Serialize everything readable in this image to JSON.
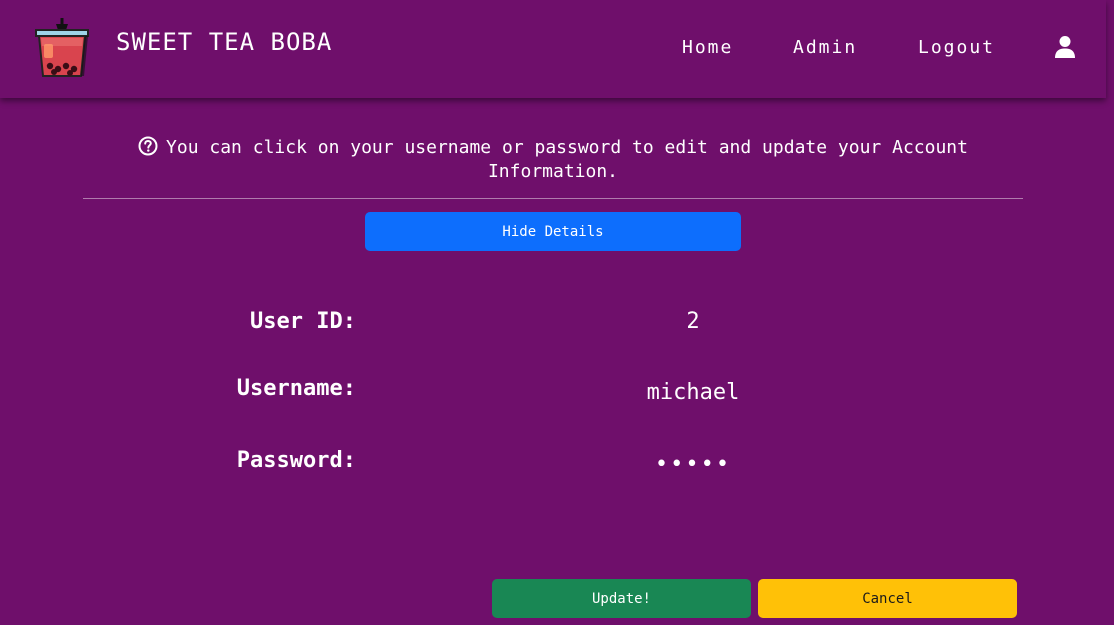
{
  "navbar": {
    "brand": "SWEET TEA BOBA",
    "links": {
      "home": "Home",
      "admin": "Admin",
      "logout": "Logout"
    }
  },
  "info": {
    "message": "You can click on your username or password to edit and update your Account Information."
  },
  "details": {
    "toggle_label": "Hide Details",
    "user_id_label": "User ID:",
    "user_id_value": "2",
    "username_label": "Username:",
    "username_value": "michael",
    "password_label": "Password:",
    "password_value": "•••••"
  },
  "actions": {
    "update_label": "Update!",
    "cancel_label": "Cancel"
  },
  "colors": {
    "background": "#6f0f6b",
    "primary": "#0d6efd",
    "success": "#198754",
    "warning": "#ffc107"
  }
}
